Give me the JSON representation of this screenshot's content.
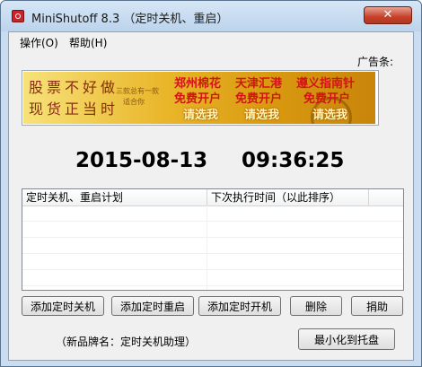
{
  "window": {
    "title": "MiniShutoff 8.3 （定时关机、重启）",
    "close_glyph": "✕"
  },
  "menu": {
    "items": [
      {
        "label": "操作(O)"
      },
      {
        "label": "帮助(H)"
      }
    ]
  },
  "ad": {
    "label": "广告条:",
    "banner": {
      "calligraphy_line1": "股票不好做",
      "calligraphy_line2": "现货正当时",
      "small_line1": "三款总有一款",
      "small_line2": "适合你",
      "offers": [
        {
          "title": "郑州棉花",
          "line2": "免费开户",
          "line3": "请选我"
        },
        {
          "title": "天津汇港",
          "line2": "免费开户",
          "line3": "请选我"
        },
        {
          "title": "遵义指南针",
          "line2": "免费开户",
          "line3": "请选我"
        }
      ]
    }
  },
  "clock": {
    "date": "2015-08-13",
    "time": "09:36:25"
  },
  "schedule_list": {
    "columns": [
      "定时关机、重启计划",
      "下次执行时间（以此排序）"
    ],
    "rows": []
  },
  "buttons": {
    "add_shutdown": "添加定时关机",
    "add_restart": "添加定时重启",
    "add_startup": "添加定时开机",
    "delete": "删除",
    "donate": "捐助",
    "minimize_tray": "最小化到托盘"
  },
  "footer": {
    "new_product": "（新品牌名：定时关机助理）"
  },
  "colors": {
    "close_button": "#c7412b",
    "titlebar": "#bcd3ec",
    "ad_red_text": "#d21414"
  }
}
